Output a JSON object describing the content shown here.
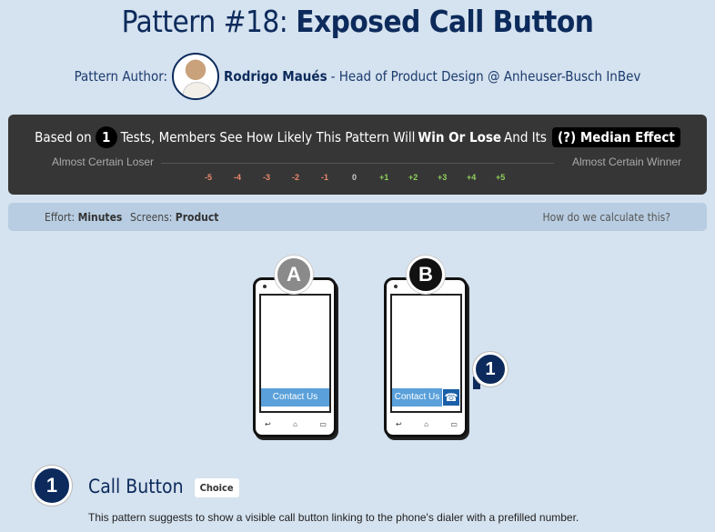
{
  "header": {
    "title_prefix": "Pattern #18:",
    "title_main": "Exposed Call Button",
    "author_label": "Pattern Author:",
    "author_name": "Rodrigo Maués",
    "author_role": "- Head of Product Design @ Anheuser-Busch InBev"
  },
  "stats": {
    "based_on": "Based on",
    "tests_count": "1",
    "tests_text": "Tests, Members See How Likely This Pattern Will",
    "win_lose": "Win Or Lose",
    "and_its": "And Its",
    "median_effect": "(?) Median Effect",
    "scale_left": "Almost Certain Loser",
    "scale_right": "Almost Certain Winner",
    "ticks": [
      {
        "label": "-5",
        "color": "#e8886b"
      },
      {
        "label": "-4",
        "color": "#e8886b"
      },
      {
        "label": "-3",
        "color": "#e8886b"
      },
      {
        "label": "-2",
        "color": "#e8886b"
      },
      {
        "label": "-1",
        "color": "#e8886b"
      },
      {
        "label": "0",
        "color": "#cccccc"
      },
      {
        "label": "+1",
        "color": "#8fcf5a"
      },
      {
        "label": "+2",
        "color": "#8fcf5a"
      },
      {
        "label": "+3",
        "color": "#8fcf5a"
      },
      {
        "label": "+4",
        "color": "#8fcf5a"
      },
      {
        "label": "+5",
        "color": "#8fcf5a"
      }
    ]
  },
  "meta": {
    "effort_label": "Effort:",
    "effort_value": "Minutes",
    "screens_label": "Screens:",
    "screens_value": "Product",
    "calc_link": "How do we calculate this?"
  },
  "variants": {
    "a_label": "A",
    "a_color": "#8a8a8a",
    "b_label": "B",
    "b_color": "#111111",
    "contact_label": "Contact Us",
    "call_icon": "☎",
    "marker_num": "1"
  },
  "section": {
    "num": "1",
    "title": "Call Button",
    "tag": "Choice",
    "description": "This pattern suggests to show a visible call button linking to the phone's dialer with a prefilled number."
  }
}
